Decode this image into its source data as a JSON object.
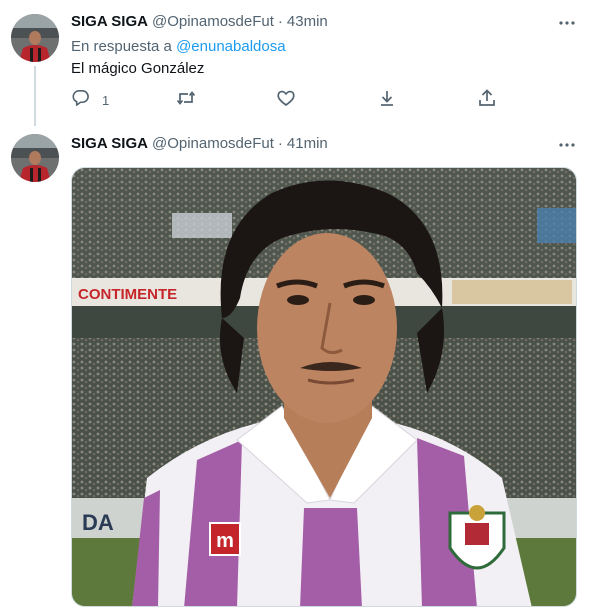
{
  "tweets": [
    {
      "display_name": "SIGA SIGA",
      "handle": "@OpinamosdeFut",
      "separator": "·",
      "time": "43min",
      "reply_prefix": "En respuesta a ",
      "reply_mention": "@enunabaldosa",
      "text": "El mágico González",
      "reply_count": "1"
    },
    {
      "display_name": "SIGA SIGA",
      "handle": "@OpinamosdeFut",
      "separator": "·",
      "time": "41min",
      "media_banner_text": "CONTIMENTE",
      "media_wall_text": "DA"
    }
  ],
  "icons": {
    "more": "more-dots-icon",
    "reply": "reply-icon",
    "retweet": "retweet-icon",
    "like": "like-icon",
    "save": "download-icon",
    "share": "share-icon"
  },
  "colors": {
    "text": "#0f1419",
    "secondary": "#536471",
    "link": "#1d9bf0",
    "divider": "#cfd9de"
  }
}
